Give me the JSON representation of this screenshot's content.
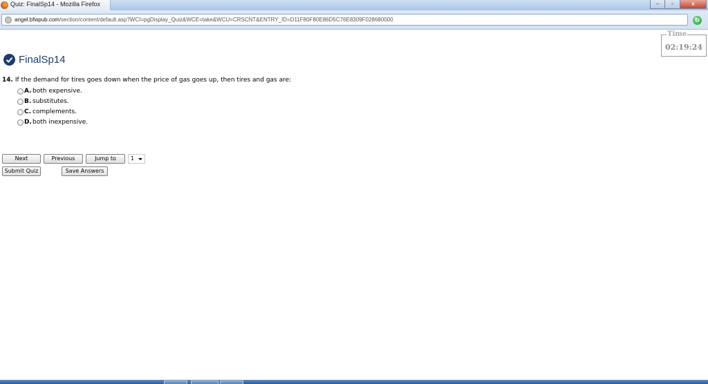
{
  "window": {
    "title": "Quiz: FinalSp14 - Mozilla Firefox",
    "controls": {
      "minimize": "–",
      "maximize": "▫",
      "close": "x"
    }
  },
  "address_bar": {
    "url_host": "angel.bfwpub.com",
    "url_path": "/section/content/default.asp?WCI=pgDisplay_Quiz&WCE=take&WCU=CRSCNT&ENTRY_ID=D11F80F80E86D5C76E8309F028680000"
  },
  "timer": {
    "label": "Time",
    "value": "02:19:24"
  },
  "quiz": {
    "title": "FinalSp14"
  },
  "question": {
    "number": "14.",
    "text": "If the demand for tires goes down when the price of gas goes up, then tires and gas are:",
    "options": [
      {
        "letter": "A.",
        "text": "both expensive."
      },
      {
        "letter": "B.",
        "text": "substitutes."
      },
      {
        "letter": "C.",
        "text": "complements."
      },
      {
        "letter": "D.",
        "text": "both inexpensive."
      }
    ]
  },
  "controls": {
    "next": "Next",
    "previous": "Previous",
    "jump_to": "Jump to",
    "jump_value": "1",
    "submit": "Submit Quiz",
    "save": "Save Answers"
  },
  "colors": {
    "accent": "#1d3d6b",
    "titlebar": "#b9d2ee",
    "taskbar": "#2b5b99"
  }
}
